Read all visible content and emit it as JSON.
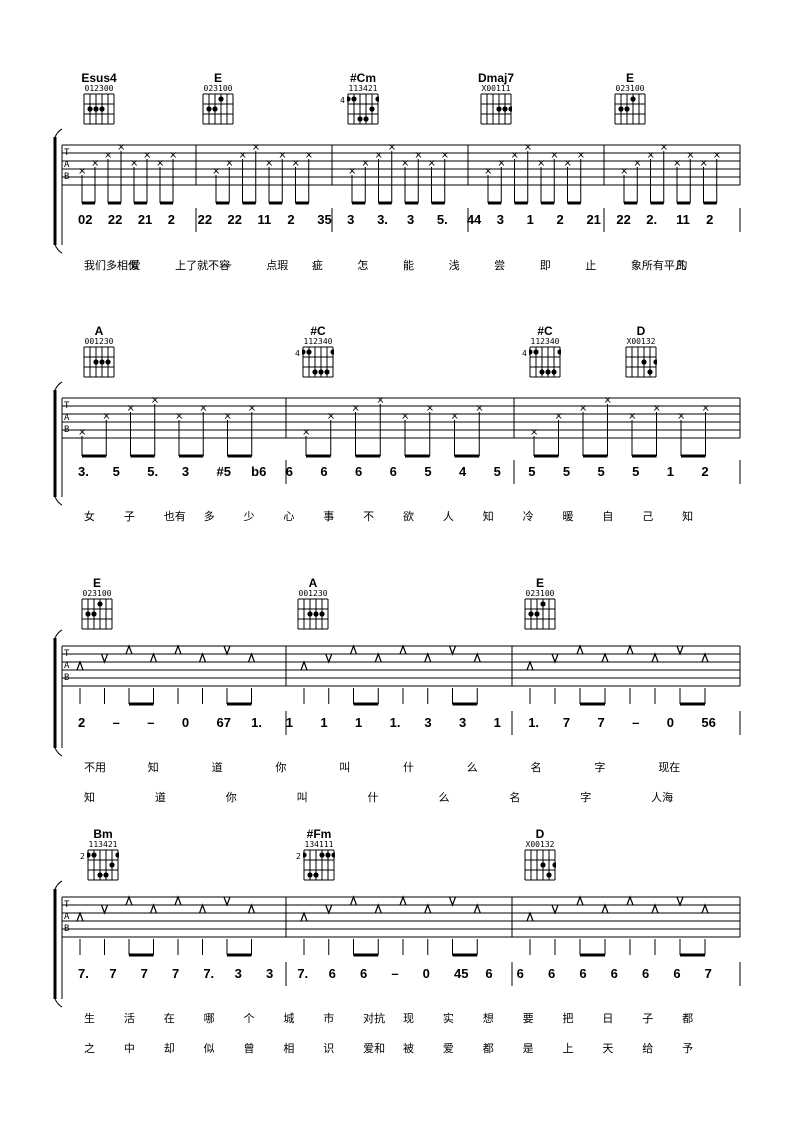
{
  "systems": [
    {
      "chords": [
        {
          "name": "Esus4",
          "fingering": "012300"
        },
        {
          "name": "E",
          "fingering": "023100"
        },
        {
          "name": "#Cm",
          "fingering": "113421",
          "fret": "4"
        },
        {
          "name": "Dmaj7",
          "fingering": "X00111"
        },
        {
          "name": "E",
          "fingering": "023100"
        }
      ],
      "notation": [
        "02",
        "22",
        "21",
        "2",
        "22",
        "22",
        "11",
        "2",
        "35",
        "3",
        "3.",
        "3",
        "5.",
        "44",
        "3",
        "1",
        "2",
        "21",
        "22",
        "2.",
        "11",
        "2"
      ],
      "lyrics": [
        "我们多相似",
        "爱",
        "上了就不容",
        "一",
        "点瑕",
        "疵",
        "怎",
        "能",
        "浅",
        "尝",
        "即",
        "止",
        "象所有平凡",
        "的"
      ]
    },
    {
      "chords": [
        {
          "name": "A",
          "fingering": "001230"
        },
        {
          "name": "#C",
          "fingering": "112340",
          "fret": "4"
        },
        {
          "name": "#C",
          "fingering": "112340",
          "fret": "4"
        },
        {
          "name": "D",
          "fingering": "X00132"
        }
      ],
      "notation": [
        "3.",
        "5",
        "5.",
        "3",
        "#5",
        "b6",
        "6",
        "6",
        "6",
        "6",
        "5",
        "4",
        "5",
        "5",
        "5",
        "5",
        "5",
        "1",
        "2"
      ],
      "lyrics": [
        "女",
        "子",
        "也有",
        "多",
        "少",
        "心",
        "事",
        "不",
        "欲",
        "人",
        "知",
        "冷",
        "暖",
        "自",
        "己",
        "知"
      ],
      "tab_fret": "2"
    },
    {
      "chords": [
        {
          "name": "E",
          "fingering": "023100"
        },
        {
          "name": "A",
          "fingering": "001230"
        },
        {
          "name": "E",
          "fingering": "023100"
        }
      ],
      "notation": [
        "2",
        "–",
        "–",
        "0",
        "67",
        "1.",
        "1",
        "1",
        "1",
        "1.",
        "3",
        "3",
        "1",
        "1.",
        "7",
        "7",
        "–",
        "0",
        "56"
      ],
      "lyrics_line1": [
        "不用",
        "知",
        "道",
        "你",
        "叫",
        "什",
        "么",
        "名",
        "字",
        "现在"
      ],
      "lyrics_line2": [
        "知",
        "道",
        "你",
        "叫",
        "什",
        "么",
        "名",
        "字",
        "人海"
      ],
      "tab_fret": "2"
    },
    {
      "chords": [
        {
          "name": "Bm",
          "fingering": "113421",
          "fret": "2"
        },
        {
          "name": "#Fm",
          "fingering": "134111",
          "fret": "2"
        },
        {
          "name": "D",
          "fingering": "X00132"
        }
      ],
      "notation": [
        "7.",
        "7",
        "7",
        "7",
        "7.",
        "3",
        "3",
        "7.",
        "6",
        "6",
        "–",
        "0",
        "45",
        "6",
        "6",
        "6",
        "6",
        "6",
        "6",
        "6",
        "7"
      ],
      "lyrics_line1": [
        "生",
        "活",
        "在",
        "哪",
        "个",
        "城",
        "市",
        "对抗",
        "现",
        "实",
        "想",
        "要",
        "把",
        "日",
        "子",
        "都"
      ],
      "lyrics_line2": [
        "之",
        "中",
        "却",
        "似",
        "曾",
        "相",
        "识",
        "爱和",
        "被",
        "爱",
        "都",
        "是",
        "上",
        "天",
        "给",
        "予"
      ]
    }
  ],
  "tab_labels": [
    "T",
    "A",
    "B"
  ]
}
